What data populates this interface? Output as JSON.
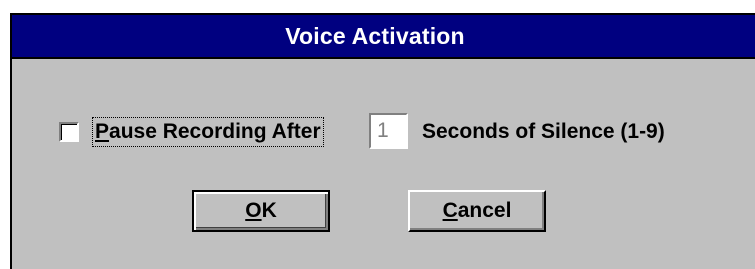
{
  "window": {
    "title": "Voice Activation"
  },
  "options": {
    "pause_checkbox": {
      "checked": false,
      "label_mnemonic": "P",
      "label_rest": "ause Recording After"
    },
    "seconds_input": {
      "value": "1"
    },
    "seconds_suffix": "Seconds of Silence (1-9)"
  },
  "buttons": {
    "ok": {
      "mnemonic": "O",
      "rest": "K"
    },
    "cancel": {
      "mnemonic": "C",
      "rest": "ancel"
    }
  },
  "colors": {
    "titlebar": "#000080",
    "face": "#c0c0c0",
    "title_text": "#ffffff",
    "disabled_text": "#808080"
  }
}
